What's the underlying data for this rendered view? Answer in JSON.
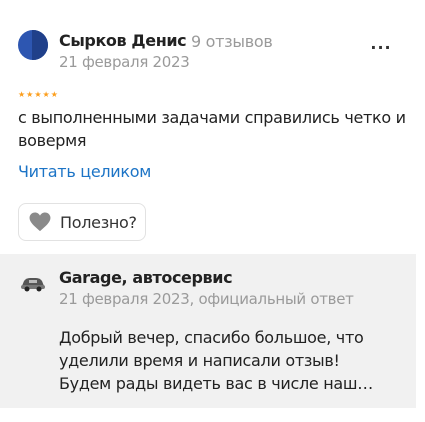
{
  "review": {
    "author_name": "Сырков Денис",
    "author_reviews_count": "9 отзывов",
    "date": "21 февраля 2023",
    "more_icon": "more-dots-icon",
    "more_label": "...",
    "rating": 5,
    "rating_max": 5,
    "star_icon": "star-icon",
    "star_color": "#fc9e1c",
    "text": "с выполненными задачами справились четко и вовермя",
    "read_more_label": "Читать целиком",
    "helpful_label": "Полезно?",
    "helpful_icon": "heart-icon"
  },
  "reply": {
    "business_name": "Garage, автосервис",
    "meta": "21 февраля 2023, официальный ответ",
    "text": "Добрый вечер, спасибо большое, что уделили время и написали отзыв! Будем рады видеть вас в числе наш…",
    "logo_icon": "car-logo-icon"
  },
  "colors": {
    "link": "#1c74c6",
    "avatar": "#2d56b1",
    "reply_background": "#f1f1f1",
    "muted_text": "#9a9a9a"
  }
}
